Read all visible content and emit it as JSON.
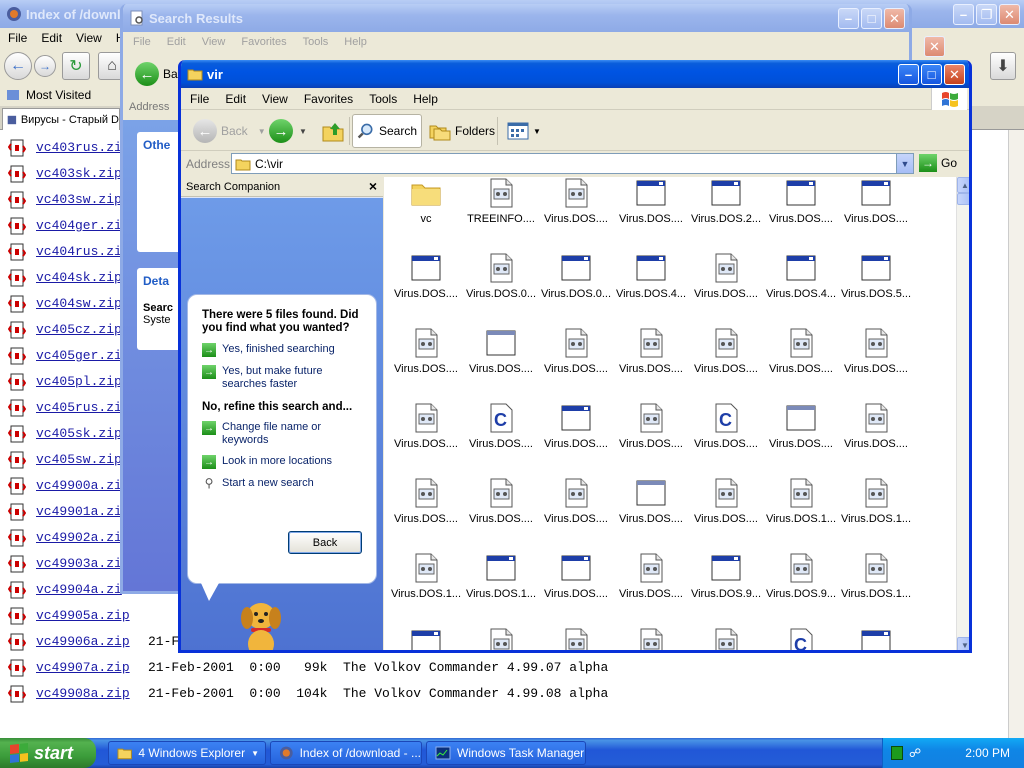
{
  "colors": {
    "xp_blue": "#0054e3",
    "link": "#1a1aa6",
    "taskbar": "#245dd7",
    "start_green": "#3c9d3b"
  },
  "firefox": {
    "title": "Index of /download",
    "menu": [
      "File",
      "Edit",
      "View",
      "H"
    ],
    "bookmark": "Most Visited",
    "tab_title": "Вирусы - Старый D",
    "rows": [
      {
        "name": "vc403rus.zi",
        "rest": ""
      },
      {
        "name": "vc403sk.zip",
        "rest": ""
      },
      {
        "name": "vc403sw.zip",
        "rest": ""
      },
      {
        "name": "vc404ger.zi",
        "rest": ""
      },
      {
        "name": "vc404rus.zi",
        "rest": ""
      },
      {
        "name": "vc404sk.zip",
        "rest": ""
      },
      {
        "name": "vc404sw.zip",
        "rest": ""
      },
      {
        "name": "vc405cz.zip",
        "rest": ""
      },
      {
        "name": "vc405ger.zi",
        "rest": ""
      },
      {
        "name": "vc405pl.zip",
        "rest": ""
      },
      {
        "name": "vc405rus.zi",
        "rest": ""
      },
      {
        "name": "vc405sk.zip",
        "rest": ""
      },
      {
        "name": "vc405sw.zip",
        "rest": ""
      },
      {
        "name": "vc49900a.zi",
        "rest": ""
      },
      {
        "name": "vc49901a.zi",
        "rest": ""
      },
      {
        "name": "vc49902a.zi",
        "rest": ""
      },
      {
        "name": "vc49903a.zi",
        "rest": ""
      },
      {
        "name": "vc49904a.zi",
        "rest": ""
      },
      {
        "name": "vc49905a.zip",
        "rest": ""
      },
      {
        "name": "vc49906a.zip",
        "rest": "21-F"
      },
      {
        "name": "vc49907a.zip",
        "rest": "21-Feb-2001  0:00   99k  The Volkov Commander 4.99.07 alpha"
      },
      {
        "name": "vc49908a.zip",
        "rest": "21-Feb-2001  0:00  104k  The Volkov Commander 4.99.08 alpha"
      }
    ]
  },
  "search_window": {
    "title": "Search Results",
    "menu": [
      "File",
      "Edit",
      "View",
      "Favorites",
      "Tools",
      "Help"
    ],
    "back_label": "Bac",
    "address_label": "Address",
    "other_label": "Othe",
    "details_label": "Deta",
    "details_text_1": "Searc",
    "details_text_2": "Syste"
  },
  "vir_window": {
    "title": "vir",
    "menu": [
      "File",
      "Edit",
      "View",
      "Favorites",
      "Tools",
      "Help"
    ],
    "toolbar": {
      "back": "Back",
      "search": "Search",
      "folders": "Folders"
    },
    "address_label": "Address",
    "address_value": "C:\\vir",
    "go_label": "Go",
    "companion": {
      "header": "Search Companion",
      "close": "×",
      "title": "There were 5 files found. Did you find what you wanted?",
      "opt1": "Yes, finished searching",
      "opt2": "Yes, but make future searches faster",
      "refine": "No, refine this search and...",
      "opt3": "Change file name or keywords",
      "opt4": "Look in more locations",
      "opt5": "Start a new search",
      "back_button": "Back"
    },
    "files": [
      {
        "label": "vc",
        "icon": "folder"
      },
      {
        "label": "TREEINFO....",
        "icon": "doc"
      },
      {
        "label": "Virus.DOS....",
        "icon": "doc"
      },
      {
        "label": "Virus.DOS....",
        "icon": "app"
      },
      {
        "label": "Virus.DOS.2...",
        "icon": "app"
      },
      {
        "label": "Virus.DOS....",
        "icon": "app"
      },
      {
        "label": "Virus.DOS....",
        "icon": "app"
      },
      {
        "label": "Virus.DOS....",
        "icon": "app"
      },
      {
        "label": "Virus.DOS.0...",
        "icon": "doc"
      },
      {
        "label": "Virus.DOS.0...",
        "icon": "app"
      },
      {
        "label": "Virus.DOS.4...",
        "icon": "app"
      },
      {
        "label": "Virus.DOS....",
        "icon": "doc"
      },
      {
        "label": "Virus.DOS.4...",
        "icon": "app"
      },
      {
        "label": "Virus.DOS.5...",
        "icon": "app"
      },
      {
        "label": "Virus.DOS....",
        "icon": "doc"
      },
      {
        "label": "Virus.DOS....",
        "icon": "blank"
      },
      {
        "label": "Virus.DOS....",
        "icon": "doc"
      },
      {
        "label": "Virus.DOS....",
        "icon": "doc"
      },
      {
        "label": "Virus.DOS....",
        "icon": "doc"
      },
      {
        "label": "Virus.DOS....",
        "icon": "doc"
      },
      {
        "label": "Virus.DOS....",
        "icon": "doc"
      },
      {
        "label": "Virus.DOS....",
        "icon": "doc"
      },
      {
        "label": "Virus.DOS....",
        "icon": "c"
      },
      {
        "label": "Virus.DOS....",
        "icon": "app"
      },
      {
        "label": "Virus.DOS....",
        "icon": "doc"
      },
      {
        "label": "Virus.DOS....",
        "icon": "c"
      },
      {
        "label": "Virus.DOS....",
        "icon": "blank"
      },
      {
        "label": "Virus.DOS....",
        "icon": "doc"
      },
      {
        "label": "Virus.DOS....",
        "icon": "doc"
      },
      {
        "label": "Virus.DOS....",
        "icon": "doc"
      },
      {
        "label": "Virus.DOS....",
        "icon": "doc"
      },
      {
        "label": "Virus.DOS....",
        "icon": "blank"
      },
      {
        "label": "Virus.DOS....",
        "icon": "doc"
      },
      {
        "label": "Virus.DOS.1...",
        "icon": "doc"
      },
      {
        "label": "Virus.DOS.1...",
        "icon": "doc"
      },
      {
        "label": "Virus.DOS.1...",
        "icon": "doc"
      },
      {
        "label": "Virus.DOS.1...",
        "icon": "app"
      },
      {
        "label": "Virus.DOS....",
        "icon": "app"
      },
      {
        "label": "Virus.DOS....",
        "icon": "doc"
      },
      {
        "label": "Virus.DOS.9...",
        "icon": "app"
      },
      {
        "label": "Virus.DOS.9...",
        "icon": "doc"
      },
      {
        "label": "Virus.DOS.1...",
        "icon": "doc"
      },
      {
        "label": "",
        "icon": "app"
      },
      {
        "label": "",
        "icon": "doc"
      },
      {
        "label": "",
        "icon": "doc"
      },
      {
        "label": "",
        "icon": "doc"
      },
      {
        "label": "",
        "icon": "doc"
      },
      {
        "label": "",
        "icon": "c"
      },
      {
        "label": "",
        "icon": "app"
      }
    ]
  },
  "taskbar": {
    "start": "start",
    "items": [
      {
        "label": "4 Windows Explorer",
        "icon": "folder-icon",
        "state": "normal"
      },
      {
        "label": "Index of /download - ...",
        "icon": "firefox-icon",
        "state": "normal"
      },
      {
        "label": "Windows Task Manager",
        "icon": "task-manager-icon",
        "state": "normal"
      }
    ],
    "clock": "2:00 PM"
  }
}
